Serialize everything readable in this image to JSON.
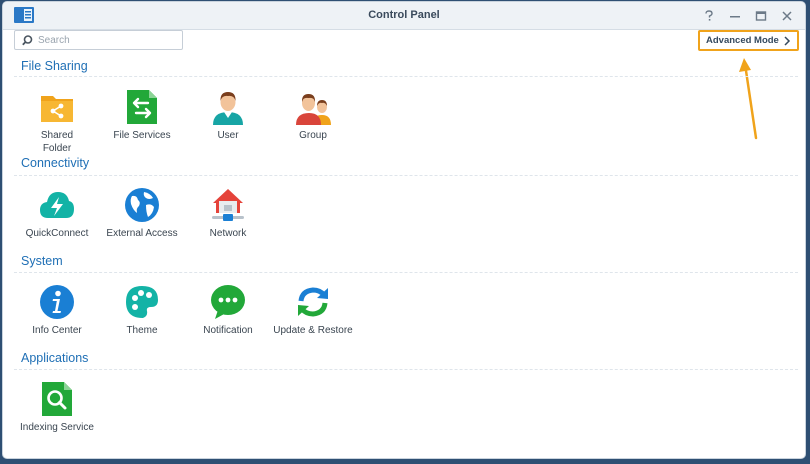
{
  "window": {
    "title": "Control Panel"
  },
  "search": {
    "placeholder": "Search",
    "value": ""
  },
  "advanced_button": {
    "label": "Advanced Mode"
  },
  "colors": {
    "accent": "#f0a31b",
    "section": "#1f6fb5"
  },
  "sections": [
    {
      "title": "File Sharing",
      "items": [
        {
          "label": "Shared\nFolder",
          "icon": "shared-folder-icon"
        },
        {
          "label": "File Services",
          "icon": "file-services-icon"
        },
        {
          "label": "User",
          "icon": "user-icon"
        },
        {
          "label": "Group",
          "icon": "group-icon"
        }
      ]
    },
    {
      "title": "Connectivity",
      "items": [
        {
          "label": "QuickConnect",
          "icon": "quickconnect-icon"
        },
        {
          "label": "External Access",
          "icon": "external-access-icon"
        },
        {
          "label": "Network",
          "icon": "network-icon"
        }
      ]
    },
    {
      "title": "System",
      "items": [
        {
          "label": "Info Center",
          "icon": "info-center-icon"
        },
        {
          "label": "Theme",
          "icon": "theme-icon"
        },
        {
          "label": "Notification",
          "icon": "notification-icon"
        },
        {
          "label": "Update & Restore",
          "icon": "update-restore-icon"
        }
      ]
    },
    {
      "title": "Applications",
      "items": [
        {
          "label": "Indexing Service",
          "icon": "indexing-service-icon"
        }
      ]
    }
  ]
}
